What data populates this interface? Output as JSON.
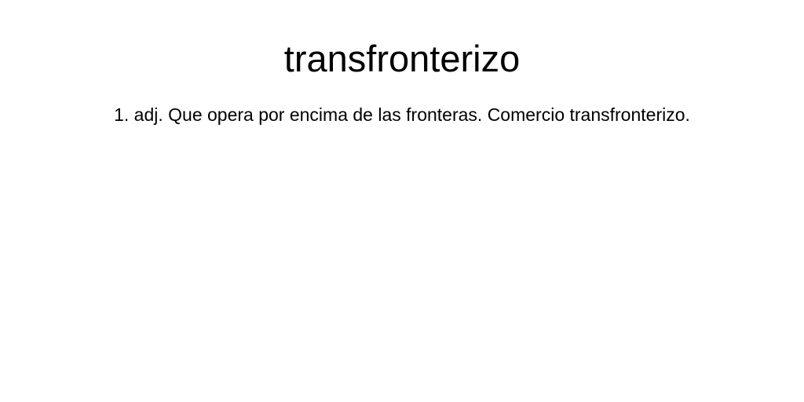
{
  "entry": {
    "headword": "transfronterizo",
    "definition": "1. adj. Que opera por encima de las fronteras. Comercio transfronterizo."
  }
}
